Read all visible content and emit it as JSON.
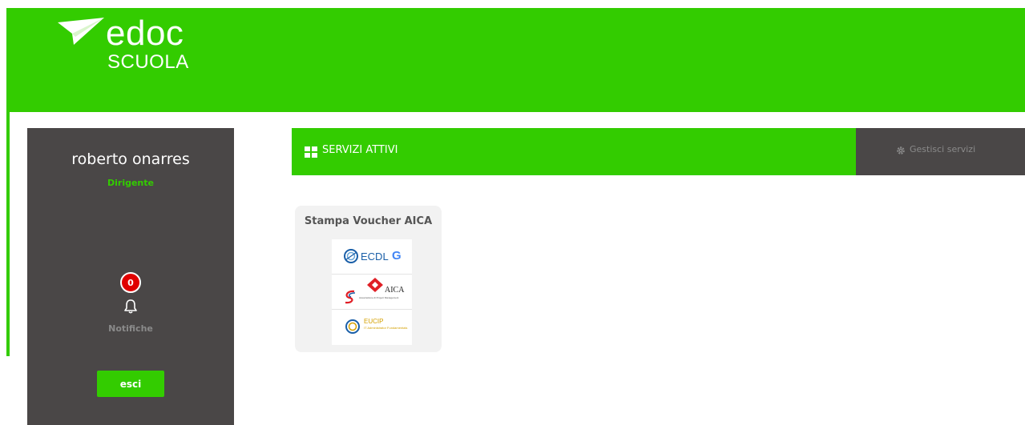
{
  "brand": {
    "logo_main": "edoc",
    "logo_sub": "SCUOLA",
    "accent_color": "#33cc00",
    "dark_color": "#4a4747"
  },
  "sidebar": {
    "user_name": "roberto onarres",
    "user_role": "Dirigente",
    "notifications_count": "0",
    "notifications_label": "Notifiche",
    "logout_label": "esci"
  },
  "services": {
    "title": "SERVIZI ATTIVI",
    "manage_label": "Gestisci servizi",
    "cards": [
      {
        "title": "Stampa Voucher AICA",
        "logos": [
          {
            "name": "ECDL",
            "text": "ECDL",
            "mark": "G"
          },
          {
            "name": "AICA",
            "text": "AICA",
            "sub": "Associazione di Project Management"
          },
          {
            "name": "EUCIP",
            "text": "EUCIP",
            "sub": "IT Administrator Fundamentals"
          }
        ]
      }
    ]
  }
}
